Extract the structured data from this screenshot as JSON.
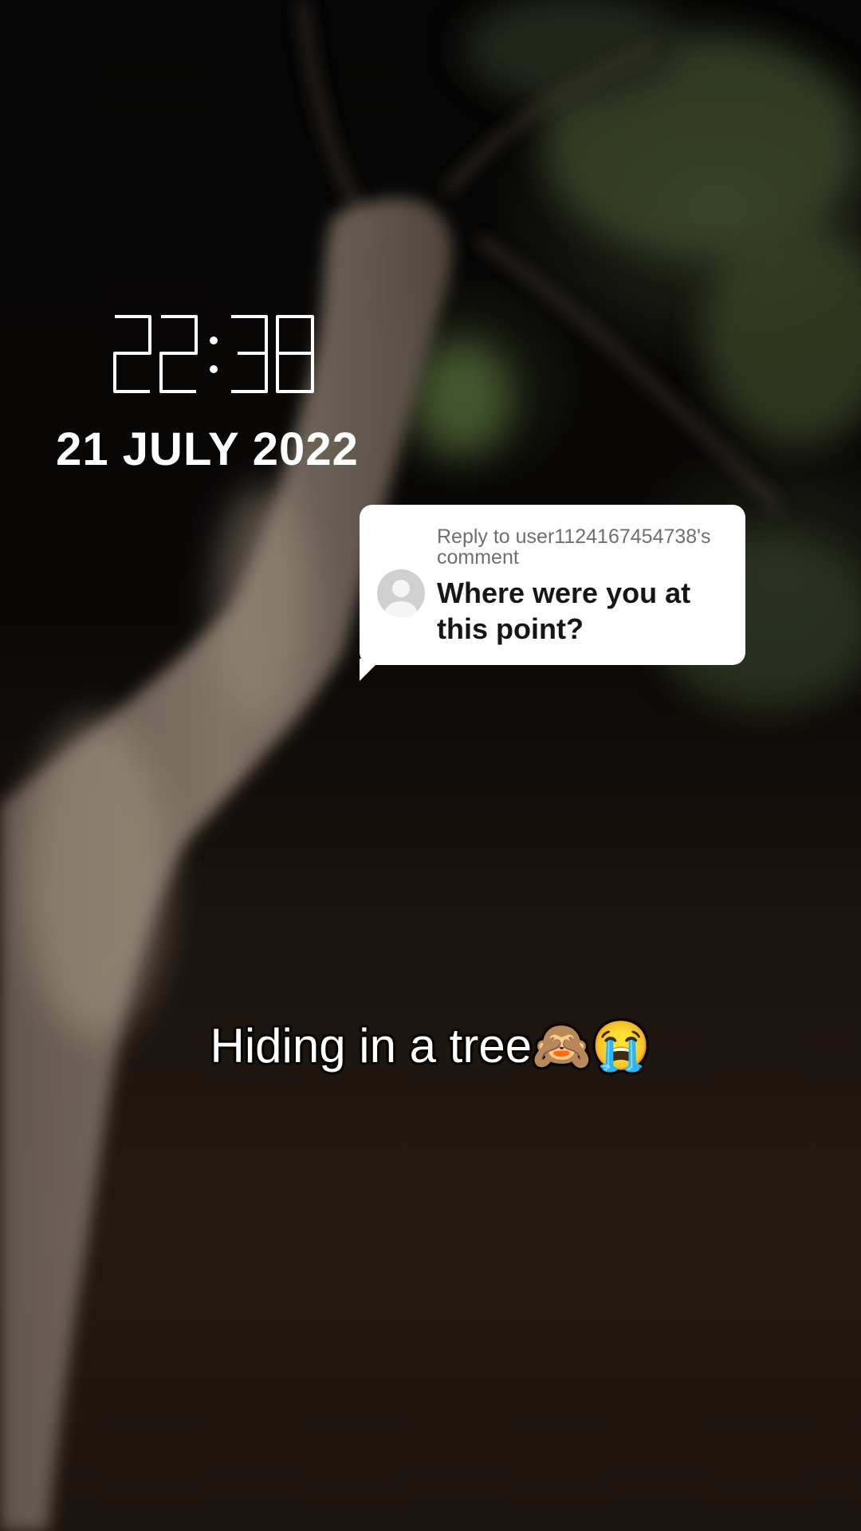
{
  "overlay": {
    "time": "22:38",
    "date": "21 JULY 2022"
  },
  "reply": {
    "header": "Reply to user1124167454738's comment",
    "body": "Where were you at this point?",
    "avatar_icon": "default-avatar-icon"
  },
  "caption": {
    "text": "Hiding in a tree🙈😭"
  },
  "colors": {
    "card_background": "#ffffff",
    "header_text": "#6f6f6f",
    "body_text": "#161616",
    "overlay_text": "#ffffff"
  }
}
